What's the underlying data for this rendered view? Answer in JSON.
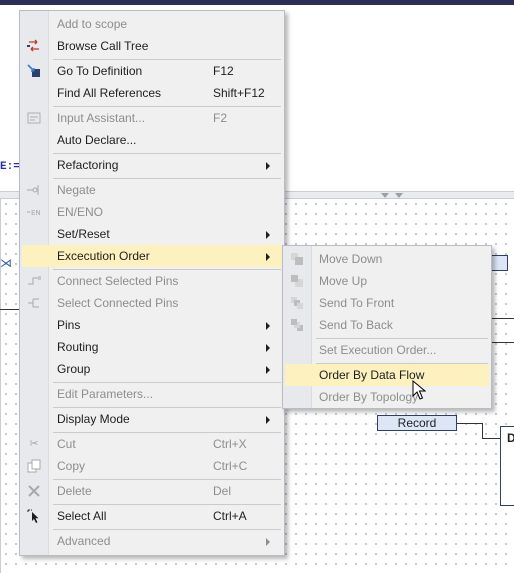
{
  "editor": {
    "code_fragment": "E:="
  },
  "diagram": {
    "record_block_label": "Record",
    "d_block_label": "D"
  },
  "context_menu": {
    "items": [
      {
        "label": "Add to scope",
        "shortcut": "",
        "icon": "scope-icon",
        "enabled": false,
        "submenu": false
      },
      {
        "label": "Browse Call Tree",
        "shortcut": "",
        "icon": "call-tree-icon",
        "enabled": true,
        "submenu": false
      },
      {
        "label": "Go To Definition",
        "shortcut": "F12",
        "icon": "go-to-definition-icon",
        "enabled": true,
        "submenu": false
      },
      {
        "label": "Find All References",
        "shortcut": "Shift+F12",
        "icon": "",
        "enabled": true,
        "submenu": false
      },
      {
        "label": "Input Assistant...",
        "shortcut": "F2",
        "icon": "input-assistant-icon",
        "enabled": false,
        "submenu": false
      },
      {
        "label": "Auto Declare...",
        "shortcut": "",
        "icon": "",
        "enabled": true,
        "submenu": false
      },
      {
        "label": "Refactoring",
        "shortcut": "",
        "icon": "",
        "enabled": true,
        "submenu": true
      },
      {
        "label": "Negate",
        "shortcut": "",
        "icon": "negate-icon",
        "enabled": false,
        "submenu": false
      },
      {
        "label": "EN/ENO",
        "shortcut": "",
        "icon": "en-eno-icon",
        "enabled": false,
        "submenu": false
      },
      {
        "label": "Set/Reset",
        "shortcut": "",
        "icon": "",
        "enabled": true,
        "submenu": true
      },
      {
        "label": "Excecution Order",
        "shortcut": "",
        "icon": "",
        "enabled": true,
        "submenu": true
      },
      {
        "label": "Connect Selected Pins",
        "shortcut": "",
        "icon": "connect-pins-icon",
        "enabled": false,
        "submenu": false
      },
      {
        "label": "Select Connected Pins",
        "shortcut": "",
        "icon": "select-pins-icon",
        "enabled": false,
        "submenu": false
      },
      {
        "label": "Pins",
        "shortcut": "",
        "icon": "",
        "enabled": true,
        "submenu": true
      },
      {
        "label": "Routing",
        "shortcut": "",
        "icon": "",
        "enabled": true,
        "submenu": true
      },
      {
        "label": "Group",
        "shortcut": "",
        "icon": "",
        "enabled": true,
        "submenu": true
      },
      {
        "label": "Edit Parameters...",
        "shortcut": "",
        "icon": "",
        "enabled": false,
        "submenu": false
      },
      {
        "label": "Display Mode",
        "shortcut": "",
        "icon": "",
        "enabled": true,
        "submenu": true
      },
      {
        "label": "Cut",
        "shortcut": "Ctrl+X",
        "icon": "scissors-icon",
        "enabled": false,
        "submenu": false
      },
      {
        "label": "Copy",
        "shortcut": "Ctrl+C",
        "icon": "copy-icon",
        "enabled": false,
        "submenu": false
      },
      {
        "label": "Delete",
        "shortcut": "Del",
        "icon": "delete-x-icon",
        "enabled": false,
        "submenu": false
      },
      {
        "label": "Select All",
        "shortcut": "Ctrl+A",
        "icon": "select-all-icon",
        "enabled": true,
        "submenu": false
      },
      {
        "label": "Advanced",
        "shortcut": "",
        "icon": "",
        "enabled": false,
        "submenu": true
      }
    ],
    "highlighted": "Excecution Order"
  },
  "execution_order_submenu": {
    "items": [
      {
        "label": "Move Down",
        "icon": "move-down-icon",
        "enabled": false
      },
      {
        "label": "Move Up",
        "icon": "move-up-icon",
        "enabled": false
      },
      {
        "label": "Send To Front",
        "icon": "send-to-front-icon",
        "enabled": false
      },
      {
        "label": "Send To Back",
        "icon": "send-to-back-icon",
        "enabled": false
      },
      {
        "label": "Set Execution Order...",
        "icon": "",
        "enabled": false
      },
      {
        "label": "Order By Data Flow",
        "icon": "",
        "enabled": true
      },
      {
        "label": "Order By Topology",
        "icon": "",
        "enabled": false
      }
    ],
    "highlighted": "Order By Data Flow"
  },
  "colors": {
    "menu_bg": "#f0f0f0",
    "highlight": "#fdf1c0",
    "disabled_text": "#8d8d8d",
    "block_fill": "#dde6f6"
  }
}
